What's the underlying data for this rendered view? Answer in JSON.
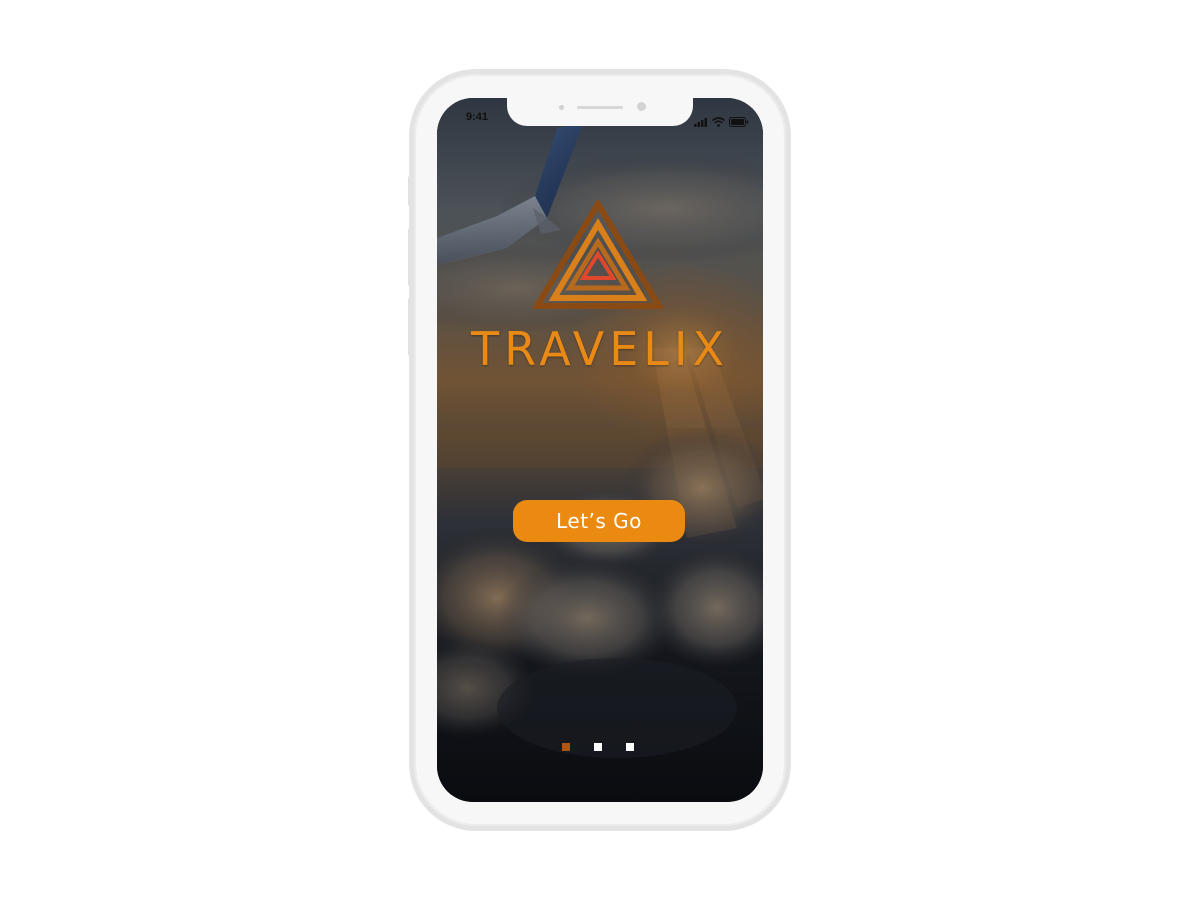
{
  "status_bar": {
    "time": "9:41",
    "icons": [
      "signal-icon",
      "wifi-icon",
      "battery-icon"
    ]
  },
  "splash": {
    "brand_name": "TRAVELIX",
    "logo_icon": "triangle-logo-icon",
    "cta_label": "Let’s Go",
    "background": "airplane-wing-above-clouds-at-sunset"
  },
  "pagination": {
    "total": 3,
    "active_index": 0
  },
  "colors": {
    "accent": "#ea8a10",
    "brand_text": "#e98a17",
    "dot_active": "#b5540f",
    "dot_idle": "#ffffff",
    "logo_outer": "#8a4a14",
    "logo_inner": "#e0482b"
  }
}
